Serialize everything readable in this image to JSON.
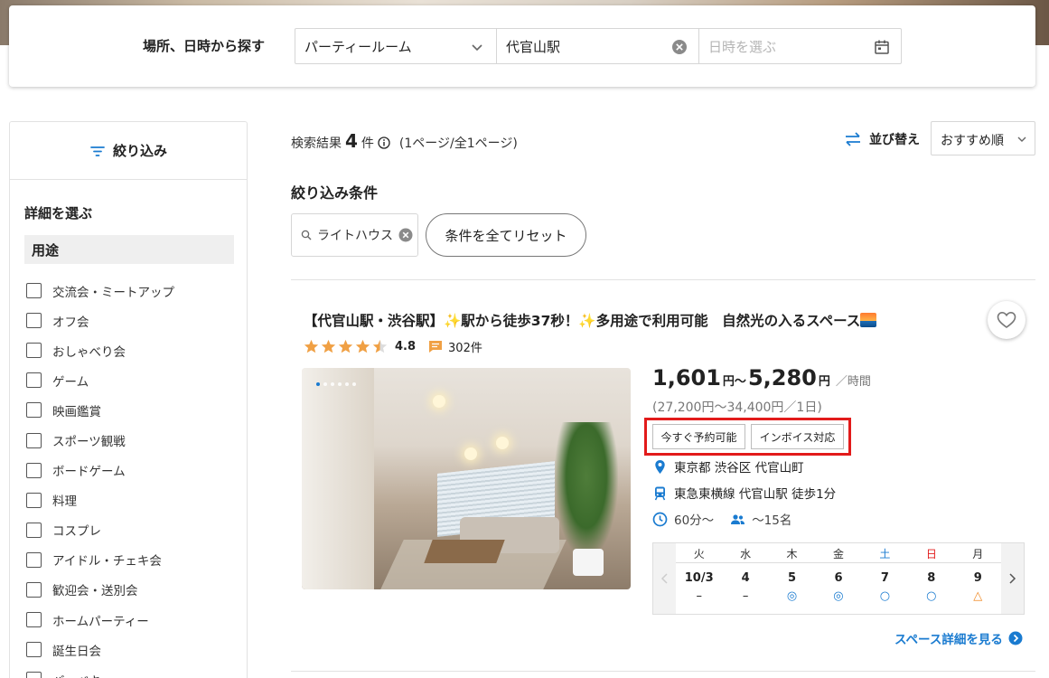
{
  "search": {
    "label": "場所、日時から探す",
    "purpose_value": "パーティールーム",
    "station_value": "代官山駅",
    "date_placeholder": "日時を選ぶ"
  },
  "sidebar": {
    "filter_label": "絞り込み",
    "detail_title": "詳細を選ぶ",
    "usage_title": "用途",
    "usage_items": [
      "交流会・ミートアップ",
      "オフ会",
      "おしゃべり会",
      "ゲーム",
      "映画鑑賞",
      "スポーツ観戦",
      "ボードゲーム",
      "料理",
      "コスプレ",
      "アイドル・チェキ会",
      "歓迎会・送別会",
      "ホームパーティー",
      "誕生日会",
      "バーベキュー"
    ]
  },
  "results": {
    "prefix": "検索結果",
    "count": "4",
    "suffix": "件",
    "page_info": "(1ページ/全1ページ)"
  },
  "sort": {
    "label": "並び替え",
    "selected": "おすすめ順"
  },
  "conditions": {
    "title": "絞り込み条件",
    "chip_label": "ライトハウス",
    "reset_label": "条件を全てリセット"
  },
  "listing": {
    "title": "【代官山駅・渋谷駅】✨駅から徒歩37秒！✨多用途で利用可能　自然光の入るスペース",
    "rating": 4.5,
    "rating_text": "4.8",
    "review_count": "302件",
    "price_min": "1,601",
    "price_tilde_unit": "円〜",
    "price_max": "5,280",
    "price_unit": "円",
    "price_per": "／時間",
    "price_day": "(27,200円〜34,400円／1日)",
    "badges": [
      "今すぐ予約可能",
      "インボイス対応"
    ],
    "address": "東京都 渋谷区 代官山町",
    "access": "東急東横線 代官山駅 徒歩1分",
    "min_time": "60分〜",
    "capacity": "〜15名",
    "photo_total": 6,
    "photo_index": 1,
    "calendar": [
      {
        "dow": "火",
        "date": "10/3",
        "mark": "–",
        "kind": "dash",
        "dow_type": "weekday"
      },
      {
        "dow": "水",
        "date": "4",
        "mark": "–",
        "kind": "dash",
        "dow_type": "weekday"
      },
      {
        "dow": "木",
        "date": "5",
        "mark": "◎",
        "kind": "double",
        "dow_type": "weekday"
      },
      {
        "dow": "金",
        "date": "6",
        "mark": "◎",
        "kind": "double",
        "dow_type": "weekday"
      },
      {
        "dow": "土",
        "date": "7",
        "mark": "○",
        "kind": "circle",
        "dow_type": "sat"
      },
      {
        "dow": "日",
        "date": "8",
        "mark": "○",
        "kind": "circle",
        "dow_type": "sun"
      },
      {
        "dow": "月",
        "date": "9",
        "mark": "△",
        "kind": "tri",
        "dow_type": "weekday"
      }
    ],
    "details_link": "スペース詳細を見る"
  },
  "colors": {
    "accent_blue": "#1a7bd0",
    "star_orange": "#f0a044",
    "highlight_red": "#e21b1b"
  }
}
